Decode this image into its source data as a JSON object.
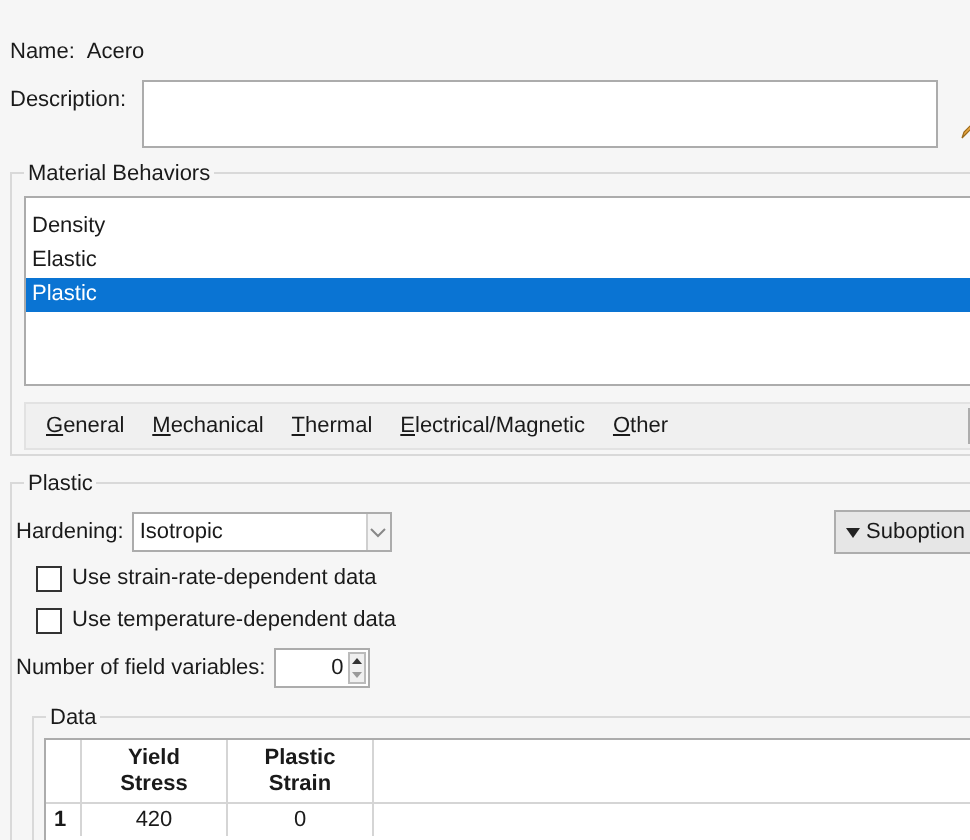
{
  "name": {
    "label": "Name:",
    "value": "Acero"
  },
  "description": {
    "label": "Description:"
  },
  "material_behaviors": {
    "title": "Material Behaviors",
    "items": [
      {
        "label": "Density",
        "selected": false
      },
      {
        "label": "Elastic",
        "selected": false
      },
      {
        "label": "Plastic",
        "selected": true
      }
    ],
    "menus": [
      {
        "label": "General",
        "mnemonic": true
      },
      {
        "label": "Mechanical",
        "mnemonic": true
      },
      {
        "label": "Thermal",
        "mnemonic": true
      },
      {
        "label": "Electrical/Magnetic",
        "mnemonic": true
      },
      {
        "label": "Other",
        "mnemonic": true
      }
    ]
  },
  "plastic": {
    "title": "Plastic",
    "hardening": {
      "label": "Hardening:",
      "value": "Isotropic"
    },
    "suboptions": "Suboption",
    "checkboxes": [
      {
        "label": "Use strain-rate-dependent data",
        "checked": false
      },
      {
        "label": "Use temperature-dependent data",
        "checked": false
      }
    ],
    "field_variables": {
      "label": "Number of field variables:",
      "value": "0"
    },
    "data": {
      "title": "Data",
      "columns": [
        "Yield Stress",
        "Plastic Strain"
      ],
      "rows": [
        {
          "index": "1",
          "cells": [
            "420",
            "0"
          ]
        }
      ]
    }
  }
}
